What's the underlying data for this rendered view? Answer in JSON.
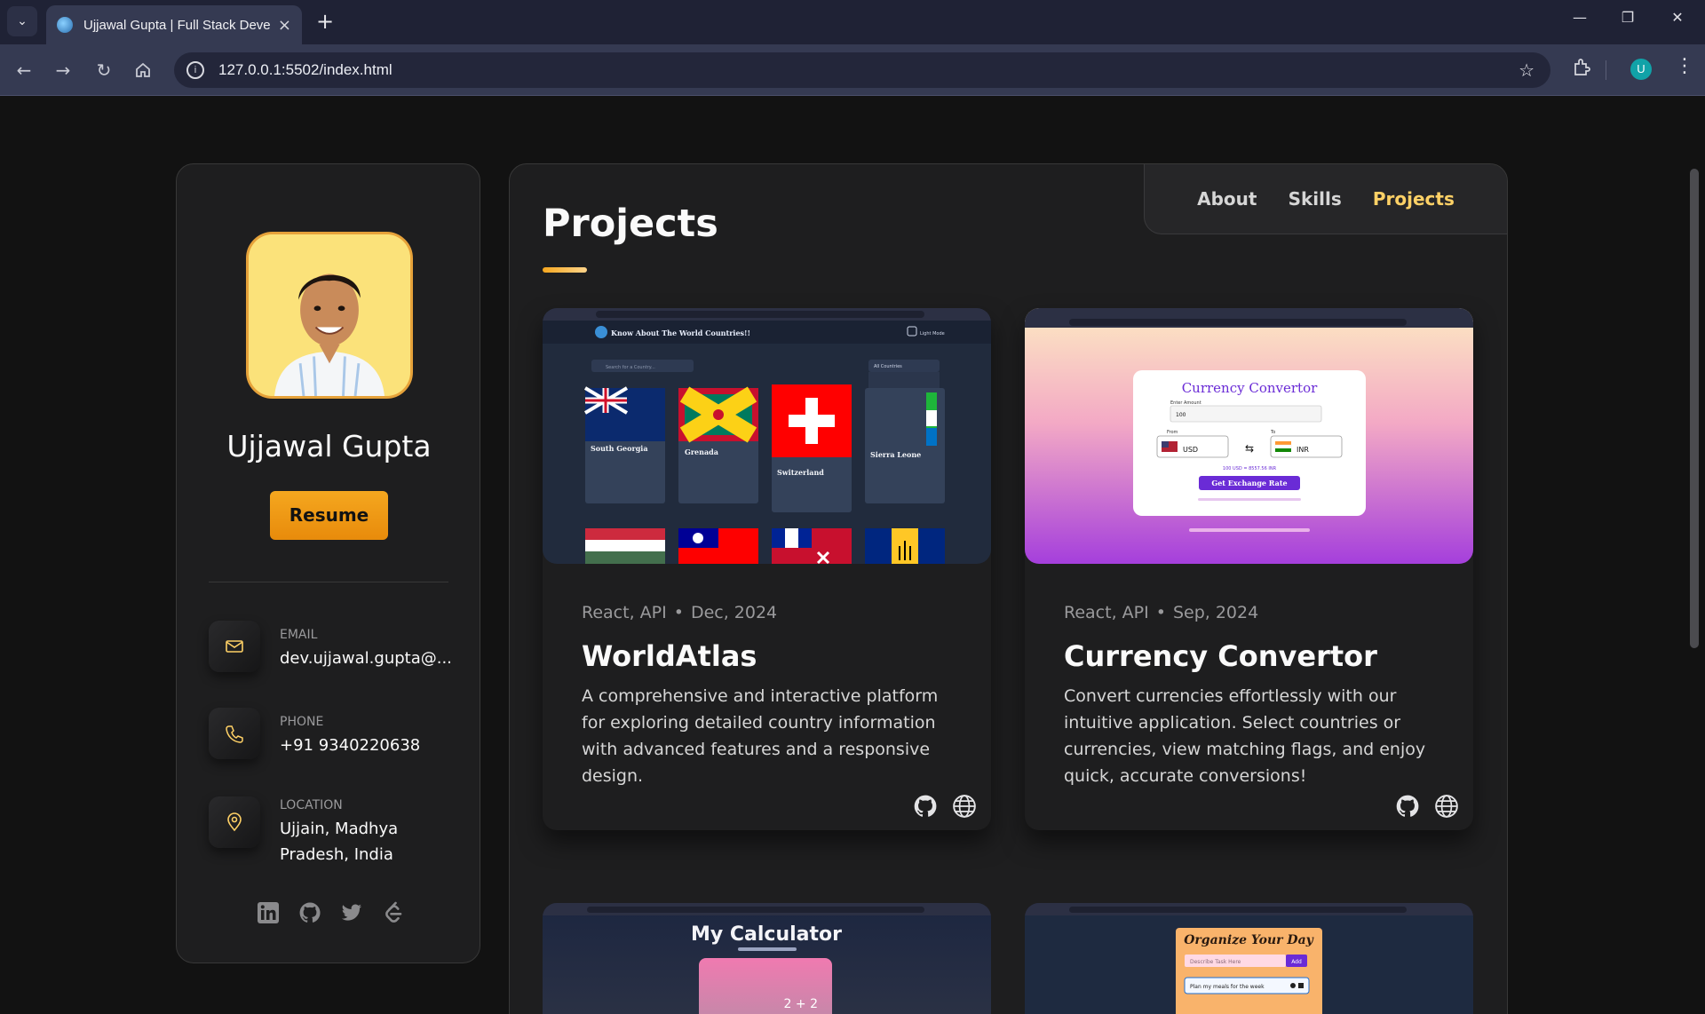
{
  "browser": {
    "tab_title": "Ujjawal Gupta | Full Stack Devel",
    "url": "127.0.0.1:5502/index.html",
    "profile_initial": "U",
    "accent": "#1f2235"
  },
  "sidebar": {
    "name": "Ujjawal Gupta",
    "resume_label": "Resume",
    "contacts": [
      {
        "label": "Email",
        "value": "dev.ujjawal.gupta@...",
        "icon": "mail-icon"
      },
      {
        "label": "Phone",
        "value": "+91 9340220638",
        "icon": "phone-icon"
      },
      {
        "label": "Location",
        "value": "Ujjain, Madhya Pradesh, India",
        "icon": "location-pin-icon"
      }
    ],
    "socials": [
      "linkedin-icon",
      "github-icon",
      "twitter-icon",
      "leetcode-icon"
    ]
  },
  "navbar": {
    "items": [
      "About",
      "Skills",
      "Projects"
    ],
    "active": "Projects",
    "active_color": "#ffd166"
  },
  "main": {
    "title": "Projects",
    "projects": [
      {
        "tags": "React, API",
        "date": "Dec, 2024",
        "title": "WorldAtlas",
        "description": "A comprehensive and interactive platform for exploring detailed country information with advanced features and a responsive design.",
        "screenshot": {
          "header": "Know About The World Countries!!",
          "search_placeholder": "Search for a Country...",
          "mode": "Light Mode",
          "filter": "All Countries",
          "countries": [
            "South Georgia",
            "Grenada",
            "Switzerland",
            "Sierra Leone"
          ]
        }
      },
      {
        "tags": "React, API",
        "date": "Sep, 2024",
        "title": "Currency Convertor",
        "description": "Convert currencies effortlessly with our intuitive application. Select countries or currencies, view matching flags, and enjoy quick, accurate conversions!",
        "screenshot": {
          "heading": "Currency Convertor",
          "amount_label": "Enter Amount",
          "amount": "100",
          "from_label": "From",
          "from": "USD",
          "to_label": "To",
          "to": "INR",
          "result": "100 USD = 8557.56 INR",
          "button": "Get Exchange Rate"
        }
      },
      {
        "screenshot": {
          "heading": "My Calculator",
          "display": "2 + 2"
        }
      },
      {
        "screenshot": {
          "heading": "Organize Your Day",
          "input_placeholder": "Describe Task Here",
          "add": "Add",
          "task": "Plan my meals for the week"
        }
      }
    ]
  }
}
